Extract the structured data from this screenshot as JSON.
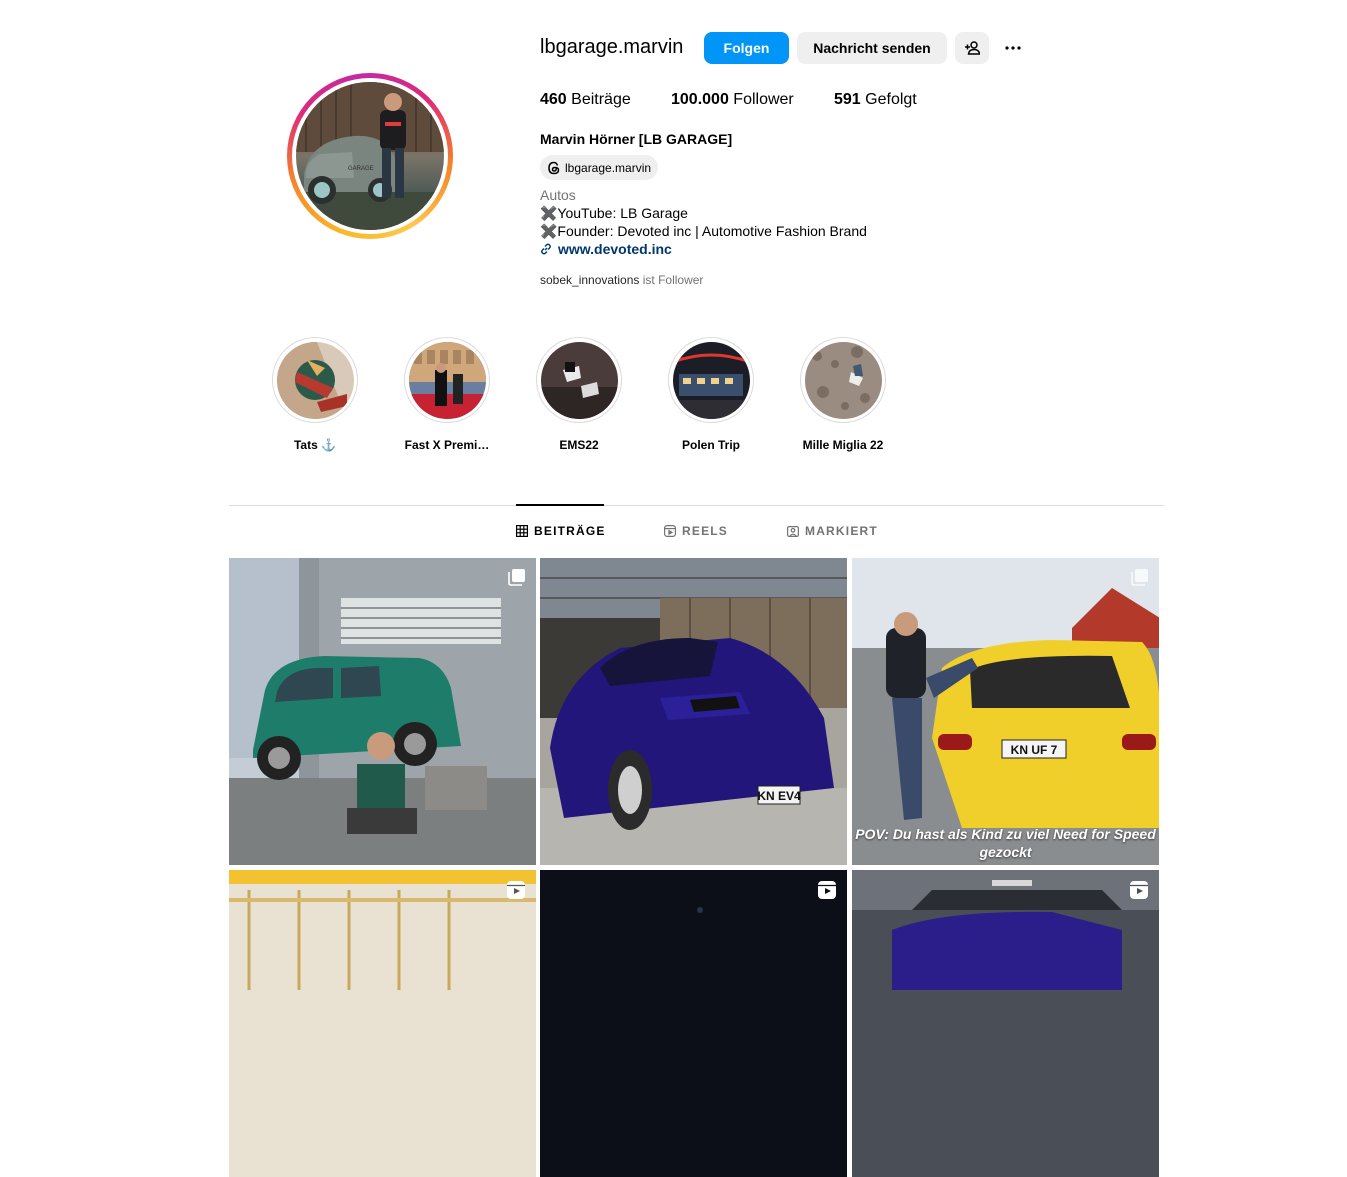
{
  "profile": {
    "username": "lbgarage.marvin",
    "follow_label": "Folgen",
    "message_label": "Nachricht senden",
    "stats": {
      "posts_count": "460",
      "posts_label": "Beiträge",
      "followers_count": "100.000",
      "followers_label": "Follower",
      "following_count": "591",
      "following_label": "Gefolgt"
    },
    "full_name": "Marvin Hörner [LB GARAGE]",
    "threads_handle": "lbgarage.marvin",
    "category": "Autos",
    "bio_lines": [
      "✖️YouTube: LB Garage",
      "✖️Founder: Devoted inc | Automotive Fashion Brand"
    ],
    "link": "www.devoted.inc",
    "followed_by_user": "sobek_innovations",
    "followed_by_suffix": "ist Follower"
  },
  "highlights": [
    {
      "label": "Tats ⚓️"
    },
    {
      "label": "Fast X Premi…"
    },
    {
      "label": "EMS22"
    },
    {
      "label": "Polen Trip"
    },
    {
      "label": "Mille Miglia 22"
    }
  ],
  "tabs": [
    {
      "label": "BEITRÄGE",
      "icon": "grid-icon",
      "active": true
    },
    {
      "label": "REELS",
      "icon": "reels-icon",
      "active": false
    },
    {
      "label": "MARKIERT",
      "icon": "tagged-icon",
      "active": false
    }
  ],
  "posts": [
    {
      "type": "carousel",
      "icon": "carousel-icon",
      "plate": ""
    },
    {
      "type": "photo",
      "icon": "",
      "plate": "KN EV4"
    },
    {
      "type": "carousel",
      "icon": "carousel-icon",
      "plate": "KN UF 7",
      "caption": "POV: Du hast als Kind zu viel Need for Speed gezockt"
    },
    {
      "type": "reel",
      "icon": "reel-icon"
    },
    {
      "type": "reel",
      "icon": "reel-icon"
    },
    {
      "type": "reel",
      "icon": "reel-icon"
    }
  ],
  "colors": {
    "accent": "#0095f6",
    "secondary_button": "#efefef",
    "link": "#00376b",
    "muted_text": "#737373",
    "divider": "#dbdbdb"
  }
}
